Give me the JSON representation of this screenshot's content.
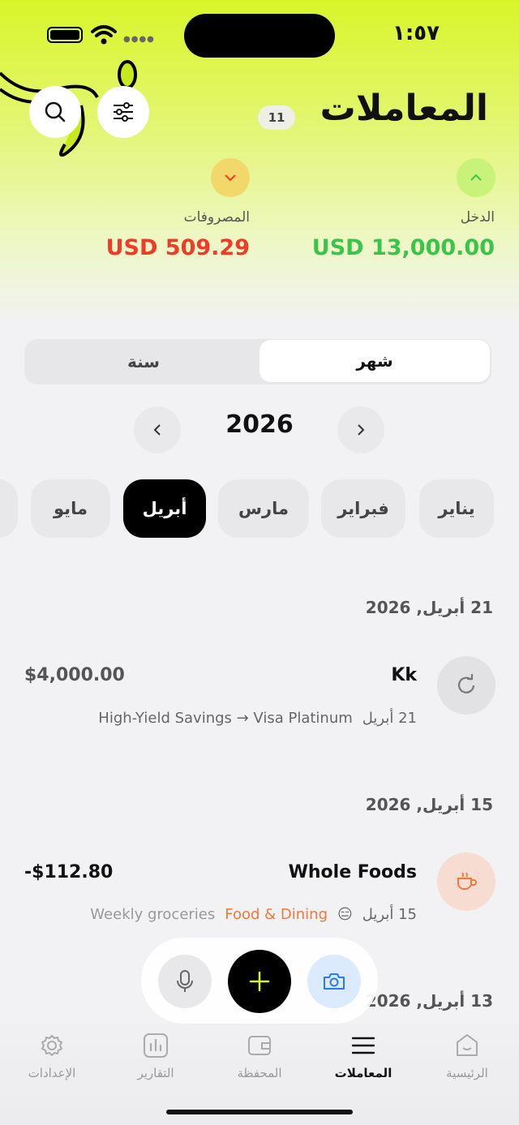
{
  "status_bar": {
    "time": "١:٥٧"
  },
  "header": {
    "title": "المعاملات",
    "count": "11",
    "income": {
      "label": "الدخل",
      "value": "USD 13,000.00",
      "color": "#3cc34a"
    },
    "expenses": {
      "label": "المصروفات",
      "value": "USD 509.29",
      "color": "#f03a2a"
    }
  },
  "period_toggle": {
    "month": "شهر",
    "year": "سنة",
    "selected": "month"
  },
  "year_nav": {
    "year": "2026"
  },
  "months": [
    "يناير",
    "فبراير",
    "مارس",
    "أبريل",
    "مايو"
  ],
  "selected_month": "أبريل",
  "groups": [
    {
      "date": "21 أبريل, 2026",
      "transactions": [
        {
          "title": "Kk",
          "amount": "$4,000.00",
          "date": "21 أبريل",
          "detail": "High-Yield Savings → Visa Platinum",
          "icon": "repeat-icon"
        }
      ]
    },
    {
      "date": "15 أبريل, 2026",
      "transactions": [
        {
          "title": "Whole Foods",
          "amount": "-$112.80",
          "date": "15 أبريل",
          "emoji": "😑",
          "category": "Food & Dining",
          "category_color": "#f07a3a",
          "note": "Weekly groceries",
          "icon": "coffee-cup-icon"
        }
      ]
    },
    {
      "date": "13 أبريل, 2026"
    }
  ],
  "tabbar": {
    "home": "الرئيسية",
    "transactions": "المعاملات",
    "wallet": "المحفظة",
    "reports": "التقارير",
    "settings": "الإعدادات",
    "active": "transactions"
  },
  "colors": {
    "accent": "#d8f52a",
    "income": "#3cc34a",
    "expense": "#f03a2a"
  }
}
